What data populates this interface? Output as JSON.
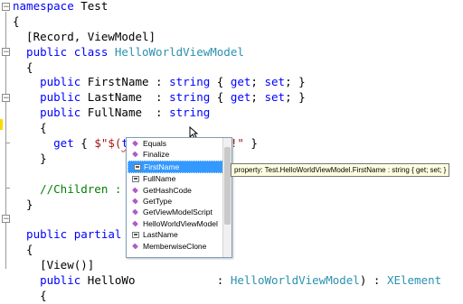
{
  "code_lines": [
    {
      "parts": [
        {
          "c": "kw",
          "t": "namespace"
        },
        {
          "c": "",
          "t": " Test"
        }
      ]
    },
    {
      "parts": [
        {
          "c": "",
          "t": "{"
        }
      ]
    },
    {
      "parts": [
        {
          "c": "",
          "t": "  [Record, ViewModel]"
        }
      ]
    },
    {
      "parts": [
        {
          "c": "kw",
          "t": "  public class "
        },
        {
          "c": "ty",
          "t": "HelloWorldViewModel"
        }
      ]
    },
    {
      "parts": [
        {
          "c": "",
          "t": "  {"
        }
      ]
    },
    {
      "parts": [
        {
          "c": "kw",
          "t": "    public"
        },
        {
          "c": "",
          "t": " FirstName : "
        },
        {
          "c": "kw",
          "t": "string"
        },
        {
          "c": "",
          "t": " { "
        },
        {
          "c": "kw",
          "t": "get"
        },
        {
          "c": "",
          "t": "; "
        },
        {
          "c": "kw",
          "t": "set"
        },
        {
          "c": "",
          "t": "; }"
        }
      ]
    },
    {
      "parts": [
        {
          "c": "kw",
          "t": "    public"
        },
        {
          "c": "",
          "t": " LastName  : "
        },
        {
          "c": "kw",
          "t": "string"
        },
        {
          "c": "",
          "t": " { "
        },
        {
          "c": "kw",
          "t": "get"
        },
        {
          "c": "",
          "t": "; "
        },
        {
          "c": "kw",
          "t": "set"
        },
        {
          "c": "",
          "t": "; }"
        }
      ]
    },
    {
      "parts": [
        {
          "c": "kw",
          "t": "    public"
        },
        {
          "c": "",
          "t": " FullName  : "
        },
        {
          "c": "kw",
          "t": "string"
        }
      ]
    },
    {
      "parts": [
        {
          "c": "",
          "t": "    {"
        }
      ]
    },
    {
      "parts": [
        {
          "c": "",
          "t": "      "
        },
        {
          "c": "kw",
          "t": "get"
        },
        {
          "c": "",
          "t": " { "
        },
        {
          "c": "str",
          "t": "$\"$("
        },
        {
          "c": "this",
          "t": "this."
        },
        {
          "c": "str",
          "t": ") $LastName!\""
        },
        {
          "c": "",
          "t": " }"
        }
      ]
    },
    {
      "parts": [
        {
          "c": "",
          "t": "    }"
        }
      ]
    },
    {
      "parts": [
        {
          "c": "",
          "t": ""
        }
      ]
    },
    {
      "parts": [
        {
          "c": "cm",
          "t": "    //Children : VI"
        }
      ]
    },
    {
      "parts": [
        {
          "c": "",
          "t": "  }"
        }
      ]
    },
    {
      "parts": [
        {
          "c": "",
          "t": ""
        }
      ]
    },
    {
      "parts": [
        {
          "c": "kw",
          "t": "  public partial mo"
        }
      ]
    },
    {
      "parts": [
        {
          "c": "",
          "t": "  {"
        }
      ]
    },
    {
      "parts": [
        {
          "c": "",
          "t": "    [View()]"
        }
      ]
    },
    {
      "parts": [
        {
          "c": "kw",
          "t": "    public"
        },
        {
          "c": "",
          "t": " HelloWo            : "
        },
        {
          "c": "ty",
          "t": "HelloWorldViewModel"
        },
        {
          "c": "",
          "t": ") : "
        },
        {
          "c": "ty",
          "t": "XElement"
        }
      ]
    },
    {
      "parts": [
        {
          "c": "",
          "t": "    {"
        }
      ]
    }
  ],
  "completion": {
    "items": [
      {
        "label": "Equals",
        "icon": "method-icon",
        "selected": false
      },
      {
        "label": "Finalize",
        "icon": "method-icon",
        "selected": false
      },
      {
        "label": "FirstName",
        "icon": "property-icon",
        "selected": true
      },
      {
        "label": "FullName",
        "icon": "property-icon",
        "selected": false
      },
      {
        "label": "GetHashCode",
        "icon": "method-icon",
        "selected": false
      },
      {
        "label": "GetType",
        "icon": "method-icon",
        "selected": false
      },
      {
        "label": "GetViewModelScript",
        "icon": "method-icon",
        "selected": false
      },
      {
        "label": "HelloWorldViewModel",
        "icon": "method-icon",
        "selected": false
      },
      {
        "label": "LastName",
        "icon": "property-icon",
        "selected": false
      },
      {
        "label": "MemberwiseClone",
        "icon": "method-icon",
        "selected": false
      }
    ]
  },
  "tooltip": {
    "text": "property: Test.HelloWorldViewModel.FirstName : string { get; set; }"
  },
  "colors": {
    "keyword": "#0000ff",
    "type": "#2b91af",
    "string": "#a31515",
    "comment": "#008000",
    "selection": "#3399ff"
  }
}
